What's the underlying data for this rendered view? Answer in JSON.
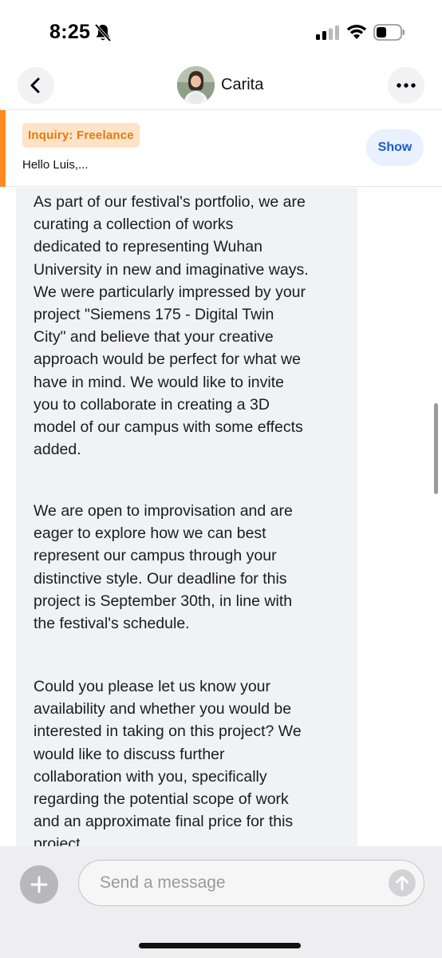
{
  "status_bar": {
    "time": "8:25",
    "icons": [
      "bell-slash-icon",
      "cellular-signal-icon",
      "wifi-icon",
      "battery-icon"
    ]
  },
  "nav": {
    "contact_name": "Carita",
    "back_icon": "chevron-left-icon",
    "more_icon": "ellipsis-icon"
  },
  "inquiry": {
    "badge": "Inquiry: Freelance",
    "preview": "Hello Luis,...",
    "show_label": "Show",
    "accent_color": "#ff8a1f"
  },
  "message": {
    "paragraphs": [
      "As part of our festival's portfolio, we are\ncurating a collection of works\ndedicated to representing Wuhan\nUniversity in new and imaginative ways.\nWe were particularly impressed by your\nproject \"Siemens 175 - Digital Twin\nCity\" and believe that your creative\napproach would be perfect for what we\nhave in mind. We would like to invite\nyou to collaborate in creating a 3D\nmodel of our campus with some effects\nadded.",
      "We are open to improvisation and are\neager to explore how we can best\nrepresent our campus through your\ndistinctive style. Our deadline for this\nproject is September 30th, in line with\nthe festival's schedule.",
      "Could you please let us know your\navailability and whether you would be\ninterested in taking on this project? We\nwould like to discuss further\ncollaboration with you, specifically\nregarding the potential scope of work\nand an approximate final price for this\nproject."
    ]
  },
  "composer": {
    "placeholder": "Send a message",
    "add_icon": "plus-icon",
    "send_icon": "arrow-up-icon"
  }
}
